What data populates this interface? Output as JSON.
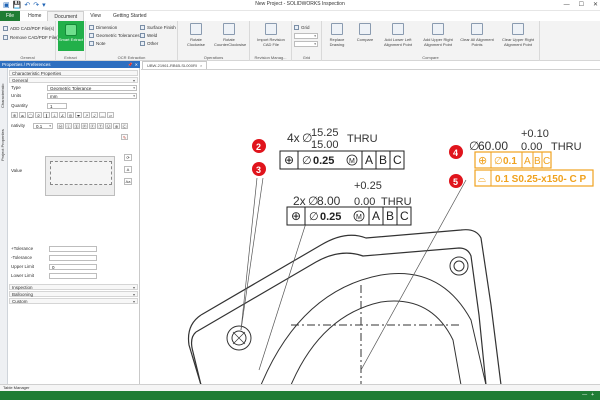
{
  "window": {
    "title": "New Project - SOLIDWORKS Inspection",
    "controls": [
      "—",
      "☐",
      "✕"
    ]
  },
  "quick_access": [
    "▣",
    "💾",
    "↶",
    "↷",
    "▾"
  ],
  "menu": {
    "file": "File",
    "tabs": [
      "Home",
      "Document",
      "View",
      "Getting Started"
    ],
    "active": "Document"
  },
  "ribbon": {
    "general": {
      "label": "General",
      "add": "ADD CAD/PDF File(s)",
      "remove": "Remove CAD/PDF File(s)"
    },
    "extract": {
      "label": "Extract",
      "smart_extract": "Smart Extract"
    },
    "ocr": {
      "label": "OCR Extraction",
      "dimension": "Dimension",
      "geometric": "Geometric Tolerances",
      "note": "Note",
      "surface": "Surface Finish",
      "weld": "Weld",
      "other": "Other"
    },
    "operations": {
      "label": "Operations",
      "rotate_cw": "Rotate Clockwise",
      "rotate_ccw": "Rotate CounterClockwise"
    },
    "revision": {
      "label": "Revision Manag...",
      "import": "Import Revision CAD File"
    },
    "grid": {
      "label": "Grid",
      "grid": "Grid"
    },
    "compare": {
      "label": "Compare",
      "replace": "Replace Drawing",
      "compare": "Compare",
      "lower_left": "Add Lower Left Alignment Point",
      "upper_right": "Add Upper Right Alignment Point",
      "clear_all": "Clear All Alignment Points",
      "clear_upper": "Clear Upper Right Alignment Point"
    }
  },
  "left_panel": {
    "header": "Properties / Preferences",
    "vertical_tabs": [
      "Characteristic",
      "Project Properties"
    ],
    "characteristic_properties": "Characteristic Properties",
    "general_section": "General",
    "type_label": "Type",
    "type_value": "Geometric Tolerance",
    "units_label": "Units",
    "units_value": "mm",
    "quantity_label": "Quantity",
    "quantity_value": "1",
    "symbols": [
      "⊕",
      "⌓",
      "◯",
      "⌭",
      "∥",
      "⊥",
      "∠",
      "◎",
      "⌯",
      "↗",
      "⌰",
      "—",
      "▱"
    ],
    "nativity_label": "nativity",
    "nativity_value": "0.1",
    "value_label": "Value",
    "plus_tol_label": "+Tolerance",
    "minus_tol_label": "-Tolerance",
    "upper_limit_label": "Upper Limit",
    "upper_limit_value": "0",
    "lower_limit_label": "Lower Limit",
    "sections": [
      "Inspection",
      "Ballooning",
      "Custom"
    ]
  },
  "document_tab": {
    "name": "UBW-21961-RB65-SL000RI",
    "close": "×"
  },
  "drawing": {
    "callout1": {
      "balloon": "2",
      "prefix": "4x",
      "diameter": "∅",
      "upper": "15.25",
      "lower": "15.00",
      "thru": "THRU",
      "symbol": "⊕",
      "tolerance": "0.25",
      "modifier": "M",
      "datums": [
        "A",
        "B",
        "C"
      ]
    },
    "balloon3": "3",
    "callout2": {
      "prefix": "2x",
      "diameter": "∅",
      "plus": "+0.25",
      "nominal": "8.00",
      "minus": "0.00",
      "thru": "THRU",
      "symbol": "⊕",
      "tolerance": "0.25",
      "modifier": "M",
      "datums": [
        "A",
        "B",
        "C"
      ]
    },
    "callout3": {
      "balloon": "4",
      "diameter": "∅",
      "plus": "+0.10",
      "nominal": "60.00",
      "minus": "0.00",
      "thru": "THRU",
      "symbol": "⊕",
      "tolerance": "0.1",
      "datums": [
        "A",
        "B",
        "C"
      ]
    },
    "callout4": {
      "balloon": "5",
      "symbol": "⌓",
      "text": "0.1 S0.25-x150- C P"
    }
  },
  "bottom": {
    "table_manager": "Table Manager"
  },
  "status": {
    "zoom": [
      "—",
      "+"
    ]
  },
  "colors": {
    "status_green": "#1f7c34",
    "file_tab": "#1f7c34",
    "smart_extract": "#22b04a",
    "balloon_red": "#e0141c",
    "selected_orange": "#f0a21e",
    "panel_header": "#2e6fc0"
  }
}
